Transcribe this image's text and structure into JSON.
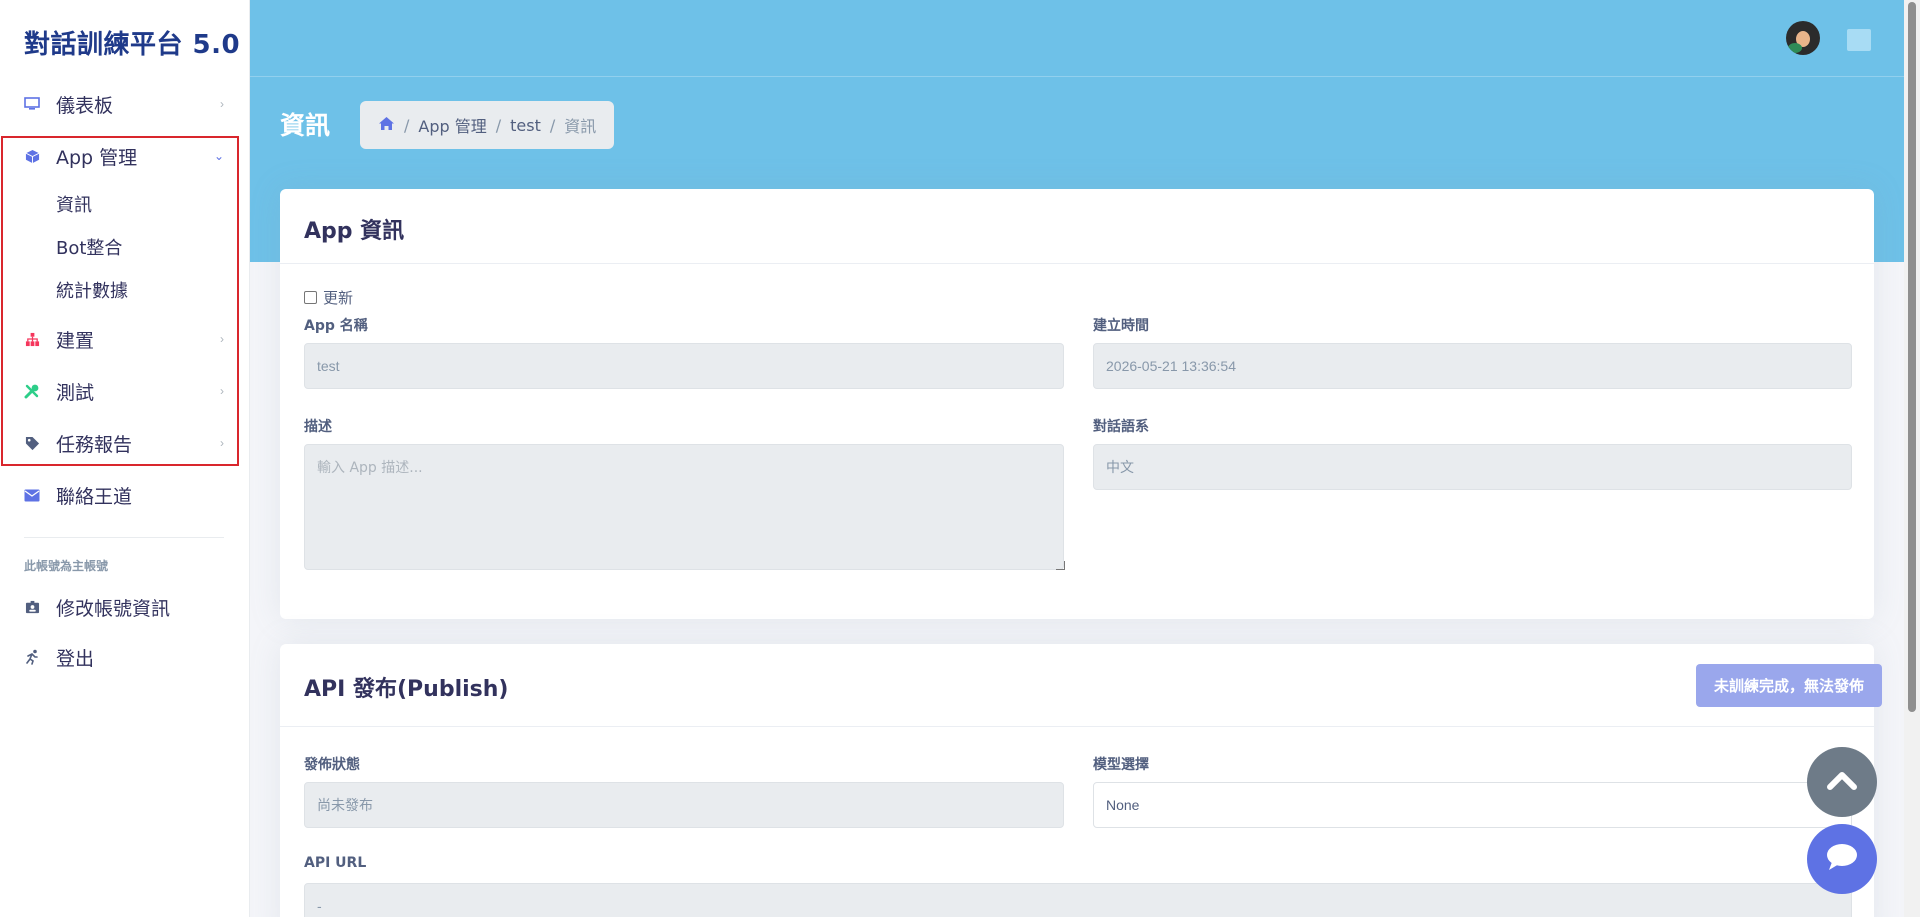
{
  "sidebar": {
    "brand": "對話訓練平台 5.0",
    "items": [
      {
        "label": "儀表板",
        "icon": "monitor-icon"
      },
      {
        "label": "App 管理",
        "icon": "cube-icon"
      },
      {
        "label": "建置",
        "icon": "sitemap-icon"
      },
      {
        "label": "測試",
        "icon": "tools-icon"
      },
      {
        "label": "任務報告",
        "icon": "tag-icon"
      },
      {
        "label": "聯絡王道",
        "icon": "envelope-icon"
      }
    ],
    "app_sub_items": [
      "資訊",
      "Bot整合",
      "統計數據"
    ],
    "section_label": "此帳號為主帳號",
    "account_items": [
      {
        "label": "修改帳號資訊",
        "icon": "id-card-icon"
      },
      {
        "label": "登出",
        "icon": "running-icon"
      }
    ]
  },
  "header": {
    "page_title": "資訊",
    "breadcrumb": [
      "App 管理",
      "test",
      "資訊"
    ]
  },
  "app_info": {
    "title": "App 資訊",
    "update_label": "更新",
    "name_label": "App 名稱",
    "name_value": "test",
    "created_label": "建立時間",
    "created_value": "2026-05-21 13:36:54",
    "desc_label": "描述",
    "desc_placeholder": "輸入 App 描述...",
    "lang_label": "對話語系",
    "lang_value": "中文"
  },
  "api_publish": {
    "title": "API 發布(Publish)",
    "button_label": "未訓練完成，無法發佈",
    "status_label": "發佈狀態",
    "status_value": "尚未發布",
    "model_label": "模型選擇",
    "model_value": "None",
    "url_label": "API URL",
    "url_value": "-"
  },
  "colors": {
    "header_bg": "#6ec1e8",
    "brand": "#1f3a8a",
    "highlight": "#d9262d",
    "primary": "#5e72e4"
  }
}
